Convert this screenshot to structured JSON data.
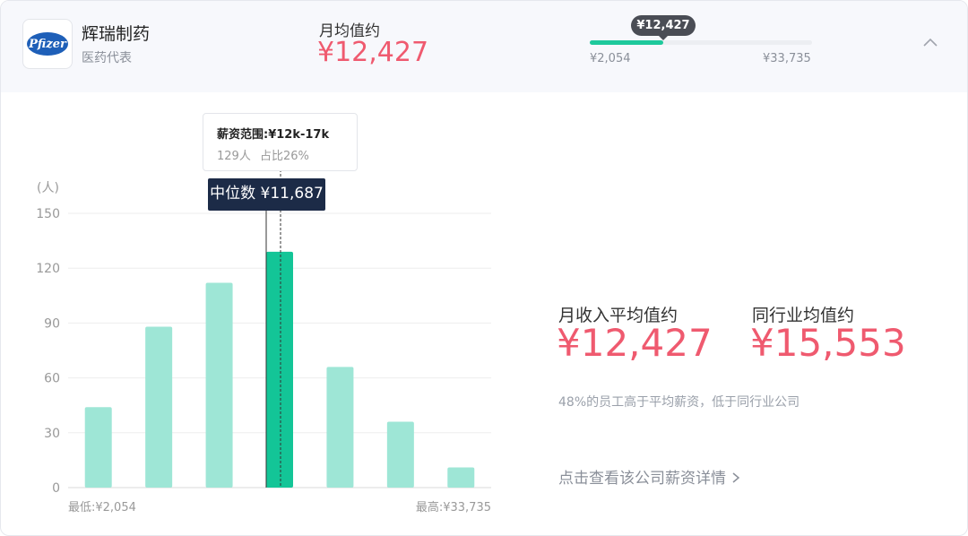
{
  "header": {
    "company": "辉瑞制药",
    "role": "医药代表",
    "logo_text": "Pfizer",
    "avg_label": "月均值约",
    "avg_value": "¥12,427",
    "range": {
      "current": "¥12,427",
      "min": "¥2,054",
      "max": "¥33,735",
      "fill_fraction": 0.33
    },
    "collapse_icon": "chevron-up-icon"
  },
  "chart_data": {
    "type": "bar",
    "ylabel": "(人)",
    "ylim": [
      0,
      150
    ],
    "yticks": [
      0,
      30,
      60,
      90,
      120,
      150
    ],
    "values": [
      44,
      88,
      112,
      129,
      66,
      36,
      11
    ],
    "highlight_index": 3,
    "x_min_label": "最低:¥2,054",
    "x_max_label": "最高:¥33,735",
    "tooltip": {
      "title": "薪资范围:¥12k-17k",
      "count": "129人",
      "share": "占比26%"
    },
    "median_label": "中位数 ¥11,687",
    "colors": {
      "bar": "#9ee6d6",
      "highlight": "#13c597",
      "grid": "#eeeeee",
      "axis_text": "#999999"
    }
  },
  "stats": {
    "avg_label": "月收入平均值约",
    "avg_value": "¥12,427",
    "industry_label": "同行业均值约",
    "industry_value": "¥15,553",
    "note": "48%的员工高于平均薪资，低于同行业公司",
    "details_link": "点击查看该公司薪资详情"
  }
}
